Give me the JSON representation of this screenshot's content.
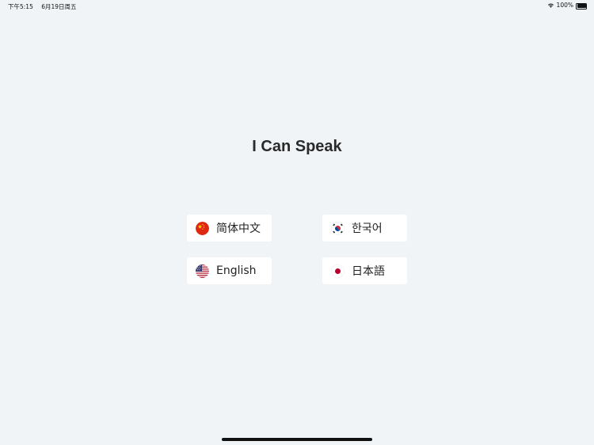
{
  "status_bar": {
    "time": "下午5:15",
    "date": "6月19日周五",
    "wifi_icon": "wifi-icon",
    "battery_percent": "100%",
    "battery_icon": "battery-icon"
  },
  "title": "I Can Speak",
  "languages": [
    {
      "label": "简体中文",
      "flag_icon": "china-flag-icon"
    },
    {
      "label": "한국어",
      "flag_icon": "korea-flag-icon"
    },
    {
      "label": "English",
      "flag_icon": "usa-flag-icon"
    },
    {
      "label": "日本語",
      "flag_icon": "japan-flag-icon"
    }
  ],
  "colors": {
    "background": "#f1f4f7",
    "button_background": "#ffffff",
    "title_text": "#2a2a2a"
  }
}
